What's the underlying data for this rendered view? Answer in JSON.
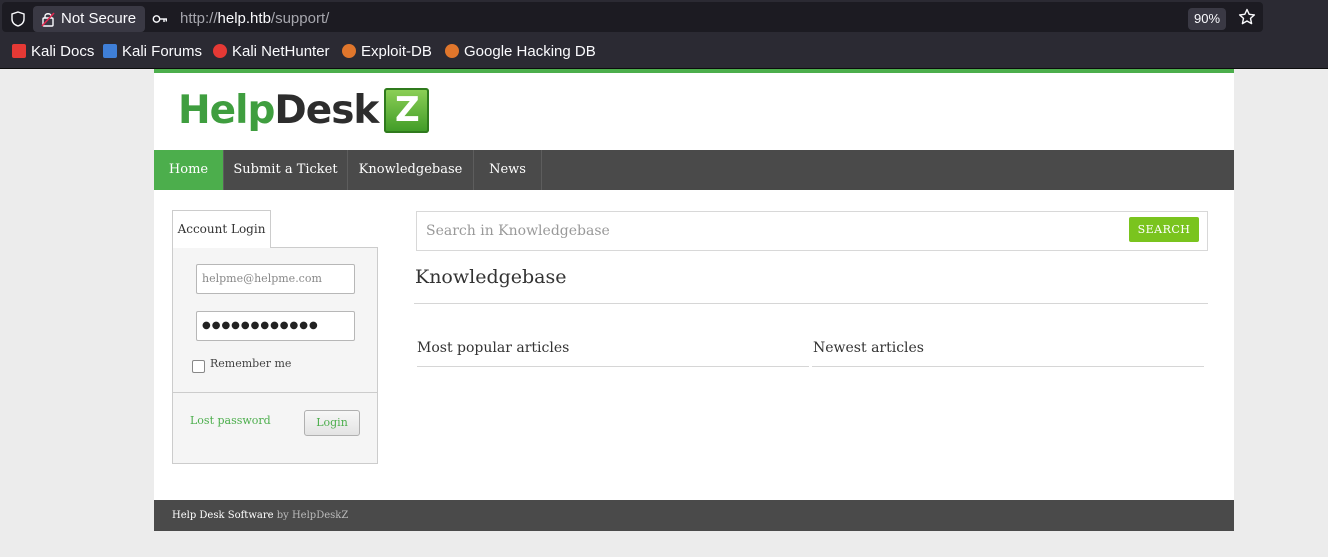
{
  "browser": {
    "security_label": "Not Secure",
    "url_prefix": "http://",
    "url_host": "help.htb",
    "url_path": "/support/",
    "zoom": "90%",
    "bookmarks": [
      {
        "label": "Kali Docs",
        "icon": "kali-docs-icon",
        "color": "#e53935"
      },
      {
        "label": "Kali Forums",
        "icon": "kali-forums-icon",
        "color": "#3f7fd8"
      },
      {
        "label": "Kali NetHunter",
        "icon": "kali-nethunter-icon",
        "color": "#e53935"
      },
      {
        "label": "Exploit-DB",
        "icon": "exploit-db-icon",
        "color": "#e0762c"
      },
      {
        "label": "Google Hacking DB",
        "icon": "ghdb-icon",
        "color": "#e0762c"
      }
    ]
  },
  "site": {
    "logo": {
      "part1": "Help",
      "part2": "Desk",
      "part3": "Z"
    },
    "nav": [
      {
        "label": "Home",
        "active": true
      },
      {
        "label": "Submit a Ticket",
        "active": false
      },
      {
        "label": "Knowledgebase",
        "active": false
      },
      {
        "label": "News",
        "active": false
      }
    ],
    "accent_color": "#4cae4c"
  },
  "login": {
    "tab_label": "Account Login",
    "email_placeholder": "helpme@helpme.com",
    "password_mask": "●●●●●●●●●●●●",
    "remember_label": "Remember me",
    "remember_checked": false,
    "lost_password": "Lost password",
    "login_button": "Login"
  },
  "search": {
    "placeholder": "Search in Knowledgebase",
    "button": "SEARCH"
  },
  "knowledgebase": {
    "title": "Knowledgebase",
    "popular": "Most popular articles",
    "newest": "Newest articles"
  },
  "footer": {
    "software": "Help Desk Software",
    "by": "by HelpDeskZ"
  }
}
